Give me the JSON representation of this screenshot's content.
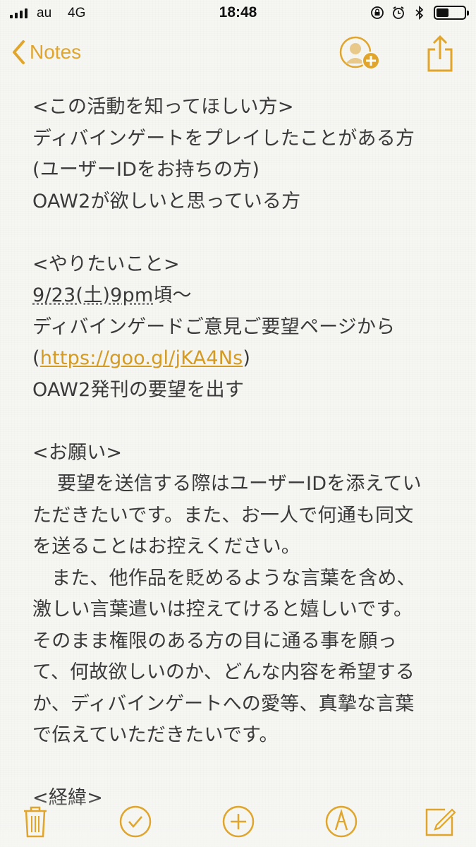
{
  "status_bar": {
    "carrier": "au",
    "network": "4G",
    "time": "18:48",
    "signal_bars": 4,
    "battery_level": 0.45
  },
  "nav": {
    "back_label": "Notes",
    "add_person_icon": "add-person-icon",
    "share_icon": "share-icon"
  },
  "note": {
    "l1": "<この活動を知ってほしい方>",
    "l2": "ディバインゲートをプレイしたことがある方",
    "l3": "(ユーザーIDをお持ちの方)",
    "l4": "OAW2が欲しいと思っている方",
    "l6": "<やりたいこと>",
    "l7_date": "9/23(土)9pm",
    "l7_rest": "頃〜",
    "l8": "ディバインゲードご意見ご要望ページから",
    "l9_open": "(",
    "l9_link": "https://goo.gl/jKA4Ns",
    "l9_close": ")",
    "l10": "OAW2発刊の要望を出す",
    "l12": "<お願い>",
    "l13": "要望を送信する際はユーザーIDを添えてい",
    "l14": "ただきたいです。また、お一人で何通も同文",
    "l15": "を送ることはお控えください。",
    "l16": "また、他作品を貶めるような言葉を含め、",
    "l17": "激しい言葉遣いは控えてけると嬉しいです。",
    "l18": "そのまま権限のある方の目に通る事を願っ",
    "l19": "て、何故欲しいのか、どんな内容を希望する",
    "l20": "か、ディバインゲートへの愛等、真摯な言葉",
    "l21": "で伝えていただきたいです。",
    "l23": "<経緯>"
  },
  "toolbar": {
    "icons": [
      "trash-icon",
      "checklist-icon",
      "add-icon",
      "sketch-icon",
      "compose-icon"
    ]
  },
  "colors": {
    "accent": "#e0a52a",
    "text": "#3a3a3a",
    "background": "#f6f6f3"
  }
}
